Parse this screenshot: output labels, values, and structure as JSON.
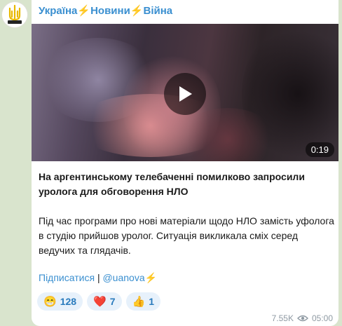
{
  "channel": {
    "name_part1": "Україна",
    "name_part2": "Новини",
    "name_part3": "Війна",
    "bolt": "⚡",
    "avatar_icon": "trident-logo-icon"
  },
  "video": {
    "duration": "0:19",
    "play_icon": "play-icon"
  },
  "post": {
    "title": "На аргентинському телебаченні помилково запросили уролога для обговорення НЛО",
    "body": "Під час програми про нові матеріали щодо НЛО замість уфолога в студію прийшов уролог. Ситуація викликала сміх серед ведучих та глядачів."
  },
  "links": {
    "subscribe": "Підписатися",
    "separator": "|",
    "handle": "@uanova",
    "bolt": "⚡"
  },
  "reactions": [
    {
      "emoji": "😁",
      "count": "128",
      "icon": "grin-emoji-icon"
    },
    {
      "emoji": "❤️",
      "count": "7",
      "icon": "heart-emoji-icon"
    },
    {
      "emoji": "👍",
      "count": "1",
      "icon": "thumbs-up-emoji-icon"
    }
  ],
  "meta": {
    "views": "7.55K",
    "time": "05:00",
    "views_icon": "eye-icon"
  },
  "colors": {
    "link": "#3a8fd0",
    "background": "#d9e4cd",
    "reaction_bg": "#e7f1fb",
    "bolt": "#f4c20d"
  }
}
